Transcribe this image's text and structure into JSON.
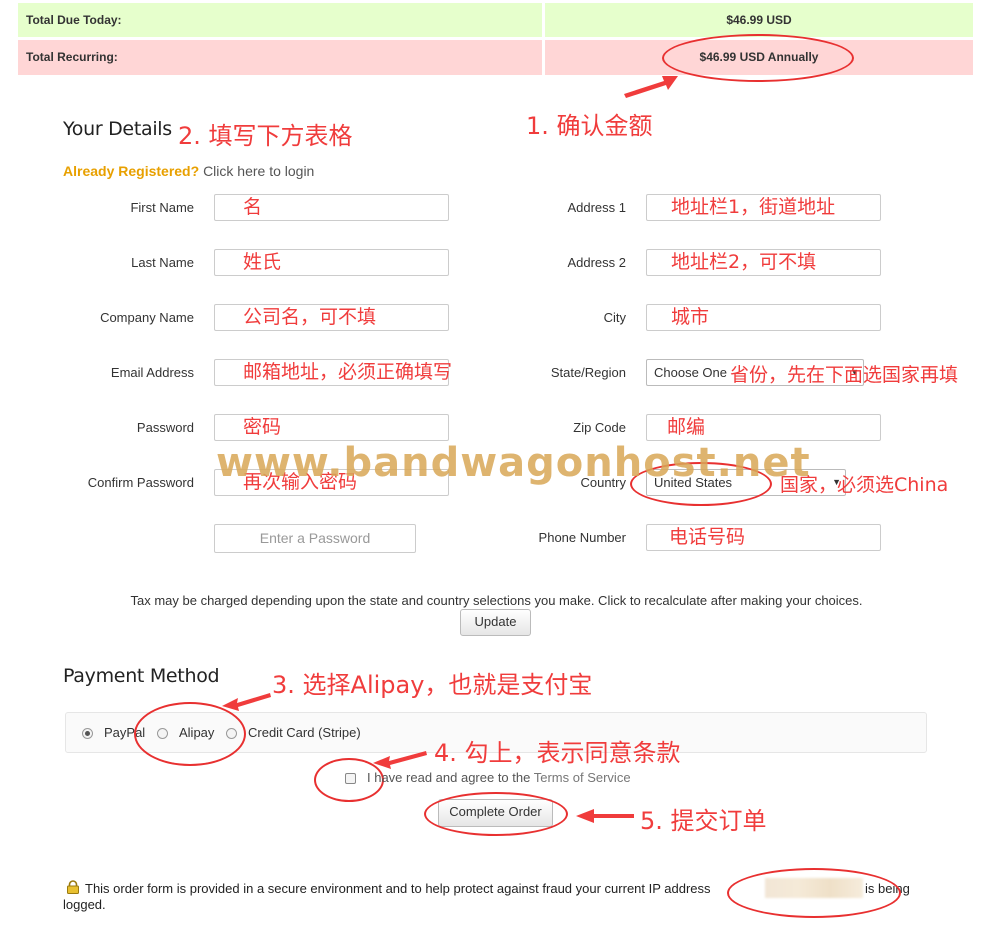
{
  "totals": {
    "due_label": "Total Due Today:",
    "due_value": "$46.99 USD",
    "recurring_label": "Total Recurring:",
    "recurring_value": "$46.99 USD Annually"
  },
  "details": {
    "heading": "Your Details",
    "already_registered": "Already Registered?",
    "login_link": "Click here to login",
    "labels": {
      "first_name": "First Name",
      "last_name": "Last Name",
      "company": "Company Name",
      "email": "Email Address",
      "password": "Password",
      "confirm_password": "Confirm Password",
      "address1": "Address 1",
      "address2": "Address 2",
      "city": "City",
      "state": "State/Region",
      "zip": "Zip Code",
      "country": "Country",
      "phone": "Phone Number"
    },
    "password_strength_placeholder": "Enter a Password",
    "state_value": "Choose One",
    "country_value": "United States",
    "tax_note": "Tax may be charged depending upon the state and country selections you make. Click to recalculate after making your choices.",
    "update_button": "Update"
  },
  "payment": {
    "heading": "Payment Method",
    "options": [
      "PayPal",
      "Alipay",
      "Credit Card (Stripe)"
    ],
    "selected": "PayPal",
    "tos_text": "I have read and agree to the",
    "tos_link": "Terms of Service",
    "complete_button": "Complete Order"
  },
  "footer": {
    "secure_text": "This order form is provided in a secure environment and to help protect against fraud your current IP address",
    "secure_text_end": "is being",
    "logged": "logged."
  },
  "annotations": {
    "step1": "1. 确认金额",
    "step2": "2. 填写下方表格",
    "step3": "3. 选择Alipay，也就是支付宝",
    "step4": "4. 勾上，表示同意条款",
    "step5": "5. 提交订单",
    "first_name": "名",
    "last_name": "姓氏",
    "company": "公司名，可不填",
    "email": "邮箱地址，必须正确填写",
    "password": "密码",
    "confirm_password": "再次输入密码",
    "address1": "地址栏1，街道地址",
    "address2": "地址栏2，可不填",
    "city": "城市",
    "state": "省份，先在下面选国家再填",
    "zip": "邮编",
    "country": "国家，必须选China",
    "phone": "电话号码",
    "watermark": "www.bandwagonhost.net"
  },
  "colors": {
    "annotation_red": "#f03c3c",
    "green_row": "#e6ffcc",
    "pink_row": "#ffd6d6",
    "link_orange": "#e8a000"
  }
}
